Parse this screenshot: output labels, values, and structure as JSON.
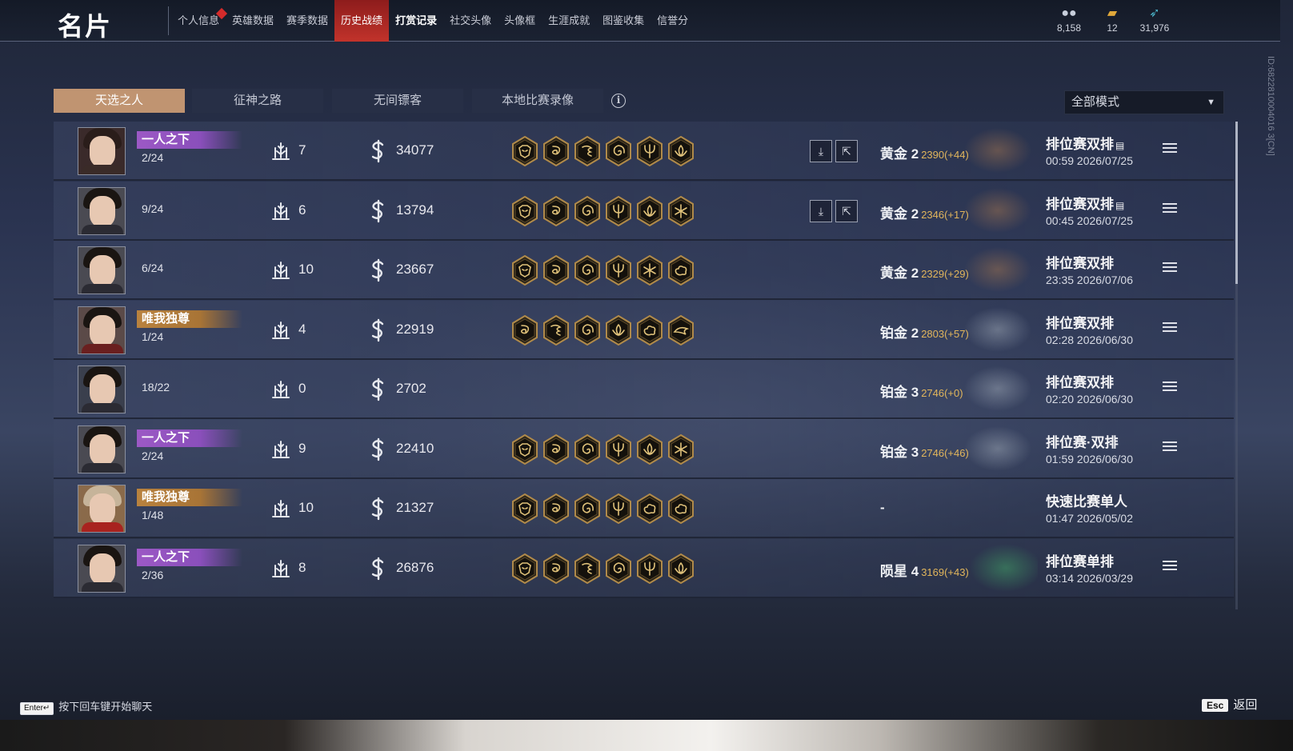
{
  "header": {
    "title": "名片",
    "nav": [
      {
        "label": "个人信息",
        "active": false,
        "bold": false,
        "dot": true
      },
      {
        "label": "英雄数据",
        "active": false,
        "bold": false,
        "dot": false
      },
      {
        "label": "赛季数据",
        "active": false,
        "bold": false,
        "dot": false
      },
      {
        "label": "历史战绩",
        "active": true,
        "bold": false,
        "dot": false
      },
      {
        "label": "打赏记录",
        "active": false,
        "bold": true,
        "dot": false
      },
      {
        "label": "社交头像",
        "active": false,
        "bold": false,
        "dot": false
      },
      {
        "label": "头像框",
        "active": false,
        "bold": false,
        "dot": false
      },
      {
        "label": "生涯成就",
        "active": false,
        "bold": false,
        "dot": false
      },
      {
        "label": "图鉴收集",
        "active": false,
        "bold": false,
        "dot": false
      },
      {
        "label": "信誉分",
        "active": false,
        "bold": false,
        "dot": false
      }
    ],
    "currencies": [
      {
        "icon": "gold-coins-icon",
        "value": "8,158"
      },
      {
        "icon": "ticket-icon",
        "value": "12"
      },
      {
        "icon": "feather-icon",
        "value": "31,976"
      }
    ]
  },
  "tabs": [
    {
      "label": "天选之人",
      "active": true
    },
    {
      "label": "征神之路",
      "active": false
    },
    {
      "label": "无间镖客",
      "active": false
    },
    {
      "label": "本地比赛录像",
      "active": false
    }
  ],
  "mode_filter": {
    "selected": "全部模式"
  },
  "matches": [
    {
      "badge": "一人之下",
      "badge_color": "purple",
      "rank": "2/24",
      "kills": "7",
      "score": "34077",
      "items": [
        "demon-mask",
        "dragon-coil",
        "dragon-scroll",
        "spiral",
        "trident",
        "lotus"
      ],
      "actions": true,
      "tier": "黄金 2",
      "points": "2390(+44)",
      "mode": "排位赛双排",
      "replay": true,
      "date": "00:59  2026/07/25",
      "avatar": "woman-hood"
    },
    {
      "badge": "",
      "badge_color": "",
      "rank": "9/24",
      "kills": "6",
      "score": "13794",
      "items": [
        "demon-mask",
        "dragon-coil",
        "spiral",
        "trident",
        "lotus",
        "snowflake"
      ],
      "actions": true,
      "tier": "黄金 2",
      "points": "2346(+17)",
      "mode": "排位赛双排",
      "replay": true,
      "date": "00:45  2026/07/25",
      "avatar": "man"
    },
    {
      "badge": "",
      "badge_color": "",
      "rank": "6/24",
      "kills": "10",
      "score": "23667",
      "items": [
        "demon-mask",
        "dragon-coil",
        "spiral",
        "trident",
        "snowflake",
        "cloud"
      ],
      "actions": false,
      "tier": "黄金 2",
      "points": "2329(+29)",
      "mode": "排位赛双排",
      "replay": false,
      "date": "23:35  2026/07/06",
      "avatar": "man"
    },
    {
      "badge": "唯我独尊",
      "badge_color": "gold",
      "rank": "1/24",
      "kills": "4",
      "score": "22919",
      "items": [
        "dragon-coil",
        "dragon-scroll",
        "spiral",
        "lotus",
        "cloud",
        "phoenix"
      ],
      "actions": false,
      "tier": "铂金 2",
      "points": "2803(+57)",
      "mode": "排位赛双排",
      "replay": false,
      "date": "02:28  2026/06/30",
      "avatar": "woman"
    },
    {
      "badge": "",
      "badge_color": "",
      "rank": "18/22",
      "kills": "0",
      "score": "2702",
      "items": [],
      "actions": false,
      "tier": "铂金 3",
      "points": "2746(+0)",
      "mode": "排位赛双排",
      "replay": false,
      "date": "02:20  2026/06/30",
      "avatar": "man-dark"
    },
    {
      "badge": "一人之下",
      "badge_color": "purple",
      "rank": "2/24",
      "kills": "9",
      "score": "22410",
      "items": [
        "demon-mask",
        "dragon-coil",
        "spiral",
        "trident",
        "lotus",
        "snowflake"
      ],
      "actions": false,
      "tier": "铂金 3",
      "points": "2746(+46)",
      "mode": "排位赛·双排",
      "replay": false,
      "date": "01:59  2026/06/30",
      "avatar": "man"
    },
    {
      "badge": "唯我独尊",
      "badge_color": "gold",
      "rank": "1/48",
      "kills": "10",
      "score": "21327",
      "items": [
        "demon-mask",
        "dragon-coil",
        "spiral",
        "trident",
        "cloud",
        "cloud"
      ],
      "actions": false,
      "tier": "-",
      "points": "",
      "mode": "快速比赛单人",
      "replay": false,
      "date": "01:47  2026/05/02",
      "avatar": "man-hat"
    },
    {
      "badge": "一人之下",
      "badge_color": "purple",
      "rank": "2/36",
      "kills": "8",
      "score": "26876",
      "items": [
        "demon-mask",
        "dragon-coil",
        "dragon-scroll",
        "spiral",
        "trident",
        "lotus"
      ],
      "actions": false,
      "tier": "陨星 4",
      "points": "3169(+43)",
      "mode": "排位赛单排",
      "replay": false,
      "date": "03:14  2026/03/29",
      "avatar": "man"
    }
  ],
  "side_id": "ID:6822810004016 3[CN]",
  "footer": {
    "enter_key": "Enter↵",
    "enter_hint": "按下回车键开始聊天",
    "esc_key": "Esc",
    "esc_label": "返回"
  },
  "colors": {
    "active_tab": "#c09471",
    "active_nav": "#c2332b",
    "points": "#e2b65c",
    "badge_purple": "#9c59c5",
    "badge_gold": "#b9823e"
  }
}
